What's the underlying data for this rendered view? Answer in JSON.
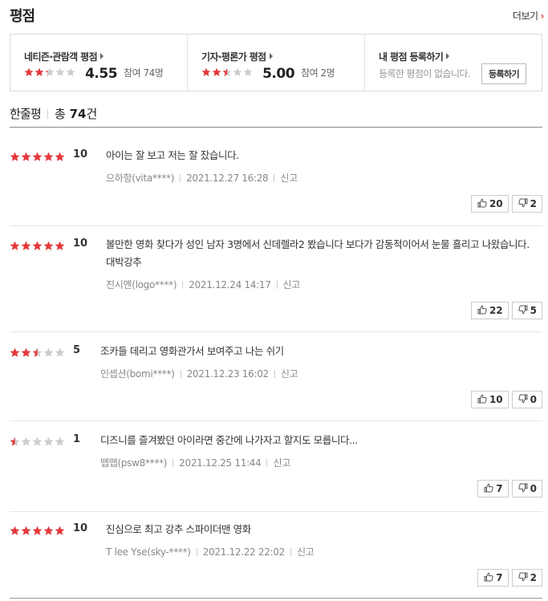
{
  "header": {
    "title": "평점",
    "more_label": "더보기",
    "more_chevron": "›"
  },
  "summary": {
    "netizen": {
      "title": "네티즌·관람객 평점",
      "stars_fill": 0.455,
      "score": "4.55",
      "count": "참여 74명"
    },
    "critic": {
      "title": "기자·평론가 평점",
      "stars_fill": 0.5,
      "score": "5.00",
      "count": "참여 2명"
    },
    "mine": {
      "title": "내 평점 등록하기",
      "desc": "등록한 평점이 없습니다.",
      "button": "등록하기"
    }
  },
  "count": {
    "label": "한줄평",
    "prefix": "총",
    "number": "74",
    "unit": "건"
  },
  "colors": {
    "star_on": "#e5383b",
    "star_off": "#cccccc",
    "accent": "#e5383b"
  },
  "reviews": [
    {
      "fill": 1.0,
      "score": "10",
      "text": "아이는 잘 보고 저는 잘 잤습니다.",
      "author": "으하항(vita****)",
      "date": "2021.12.27 16:28",
      "report": "신고",
      "up": "20",
      "down": "2"
    },
    {
      "fill": 1.0,
      "score": "10",
      "text": "볼만한 영화 찾다가 성인 남자 3명에서 신데렐라2 봤습니다 보다가 감동적이어서 눈물 흘리고 나왔습니다. 대박강추",
      "author": "진시엔(logo****)",
      "date": "2021.12.24 14:17",
      "report": "신고",
      "up": "22",
      "down": "5"
    },
    {
      "fill": 0.5,
      "score": "5",
      "text": "조카들 데리고 영화관가서 보여주고 나는 쉬기",
      "author": "인셉션(bomi****)",
      "date": "2021.12.23 16:02",
      "report": "신고",
      "up": "10",
      "down": "0"
    },
    {
      "fill": 0.1,
      "score": "1",
      "text": "디즈니를 즐겨봤던 아이라면 중간에 나가자고 할지도 모릅니다...",
      "author": "뗍뗍(psw8****)",
      "date": "2021.12.25 11:44",
      "report": "신고",
      "up": "7",
      "down": "0"
    },
    {
      "fill": 1.0,
      "score": "10",
      "text": "진심으로 최고 강추 스파이더맨 영화",
      "author": "T lee Yse(sky-****)",
      "date": "2021.12.22 22:02",
      "report": "신고",
      "up": "7",
      "down": "2"
    }
  ]
}
